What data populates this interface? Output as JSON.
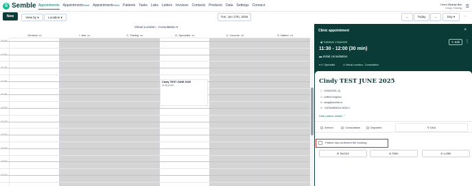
{
  "app": {
    "logo_text": "Semble",
    "logo_letter": "S"
  },
  "nav": {
    "items": [
      {
        "label": "Appointments",
        "badge": ""
      },
      {
        "label": "Appointments",
        "badge": "Beta"
      },
      {
        "label": "Appointments",
        "badge": "Beta"
      },
      {
        "label": "Patients",
        "badge": ""
      },
      {
        "label": "Tasks",
        "badge": ""
      },
      {
        "label": "Labs",
        "badge": ""
      },
      {
        "label": "Letters",
        "badge": ""
      },
      {
        "label": "Invoices",
        "badge": ""
      },
      {
        "label": "Contacts",
        "badge": ""
      },
      {
        "label": "Products",
        "badge": ""
      },
      {
        "label": "Data",
        "badge": ""
      },
      {
        "label": "Settings",
        "badge": ""
      },
      {
        "label": "Connect",
        "badge": ""
      }
    ],
    "user_org": "Cee's Beauty Bar",
    "user_name": "Cindy Testing"
  },
  "toolbar": {
    "new_label": "New",
    "view_by_label": "View by ▾",
    "location_label": "Location ▾",
    "date_label": "Tue, Jun 17th, 2025",
    "prev_label": "←",
    "today_label": "Today",
    "next_label": "→",
    "day_label": "Day ▾",
    "more_label": "···"
  },
  "calendar": {
    "location_header": "Virtual Location - Consultation ▾",
    "columns": [
      {
        "label": "General",
        "dots": "•••",
        "grey": false
      },
      {
        "label": "t. test",
        "dots": "•••",
        "grey": true
      },
      {
        "label": "C. Testing",
        "dots": "•••",
        "grey": true
      },
      {
        "label": "H. Specialist",
        "dots": "•••",
        "grey": false
      },
      {
        "label": "C. Locumn",
        "dots": "•••",
        "grey": true
      },
      {
        "label": "S. Nature",
        "dots": "•••",
        "grey": true
      }
    ],
    "times": [
      "10:45",
      "11:00",
      "11:15",
      "11:30",
      "11:45",
      "12:00",
      "12:15",
      "12:30",
      "12:45",
      "13:00",
      "13:15"
    ],
    "appointment": {
      "title": "Cindy TEST JUNE 2025",
      "time": "11:30-12:00"
    }
  },
  "panel": {
    "title": "Clinic appointment",
    "close_icon": "×",
    "date": "TUESDAY 17/06/2025",
    "time": "11:30 - 12:00  (30 min)",
    "type": "Initial consultation",
    "practitioner": "H. Specialist",
    "location": "Virtual Location - Consultation",
    "edit_label": "Edit",
    "dots": "⋮"
  },
  "patient": {
    "name": "Cindy TEST JUNE 2025",
    "dob": "20/06/2025, 0y",
    "country": "United Kingdom",
    "email": "cindy@semble.io",
    "phone": "+447845608111 MOB C",
    "hide_details": "Hide patient details ⌃",
    "statuses": [
      "Arrived",
      "Consultation",
      "Departed"
    ],
    "dna_label": "DNA",
    "confirm_label": "Patient has confirmed the booking",
    "actions": [
      "Invoice",
      "Note",
      "Letter"
    ]
  }
}
